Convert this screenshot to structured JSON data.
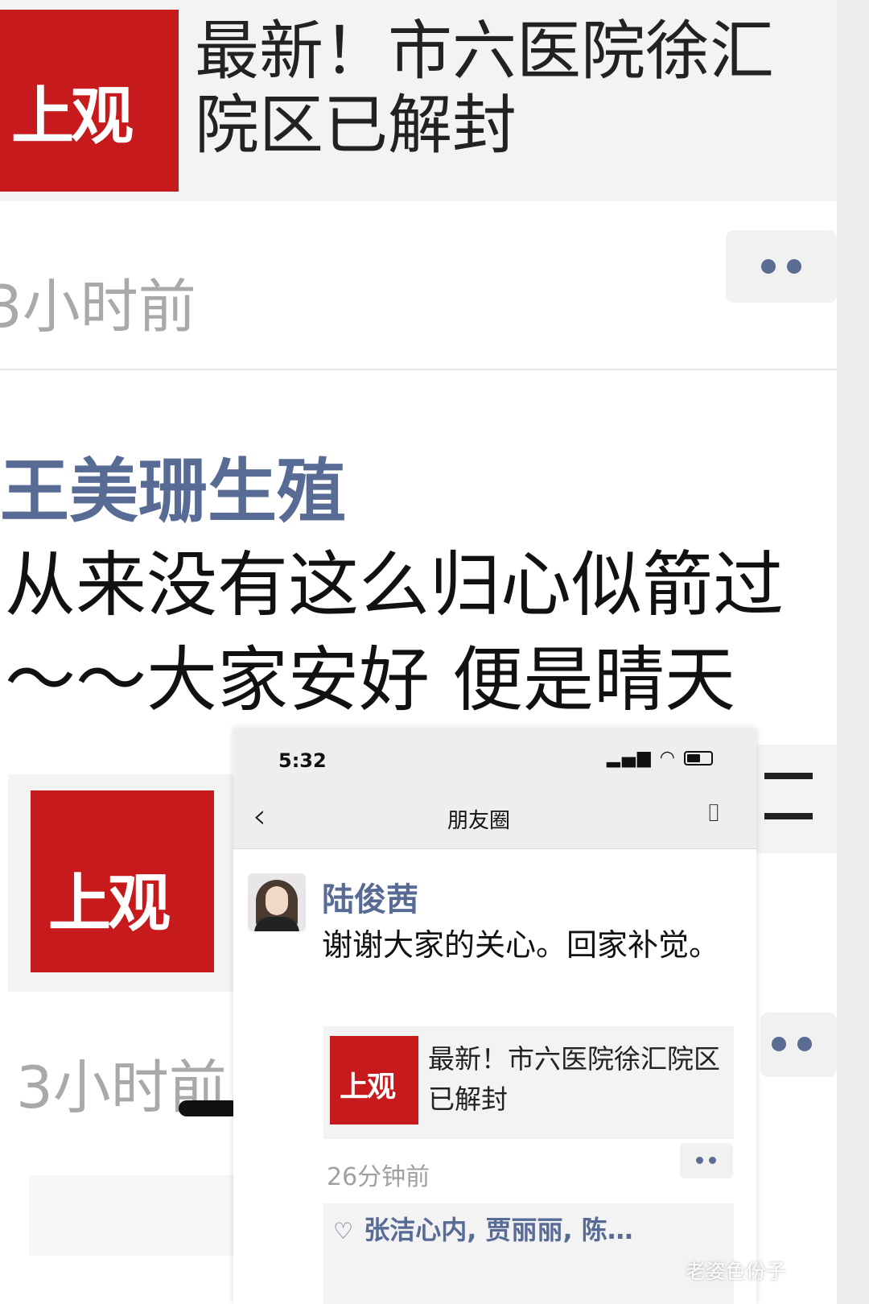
{
  "background": {
    "logo_text": "上观",
    "link_title": "最新！市六医院徐汇院区已解封",
    "time": "3小时前",
    "author": "王美珊生殖",
    "post_text": "从来没有这么归心似箭过～～大家安好 便是晴天",
    "time_bottom": "3小时前"
  },
  "status_bar": {
    "time": "5:32",
    "icons": "signal-icon wifi-icon battery-icon"
  },
  "nav": {
    "title": "朋友圈"
  },
  "post": {
    "author": "陆俊茜",
    "text": "谢谢大家的关心。回家补觉。",
    "link_logo_text": "上观",
    "link_title": "最新！市六医院徐汇院区已解封",
    "time": "26分钟前",
    "likes": "张洁心内, 贾丽丽, 陈…"
  },
  "watermark": "老姿色份子",
  "colors": {
    "brand_red": "#c71a1d",
    "link_blue": "#576b95",
    "time_gray": "#a9a9a9"
  }
}
